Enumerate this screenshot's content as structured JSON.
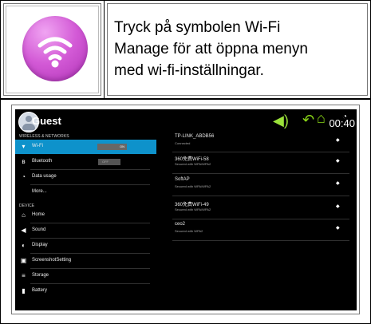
{
  "instruction": {
    "line1": "Tryck på symbolen Wi-Fi",
    "line2": "Manage för att öppna menyn",
    "line3": "med wi-fi-inställningar."
  },
  "status_bar": {
    "user": "Guest",
    "clock": "00:40",
    "icons": [
      "volume-icon",
      "back-icon",
      "home-icon",
      "wifi-signal-icon"
    ]
  },
  "settings": {
    "wireless_section": "WIRELESS & NETWORKS",
    "device_section": "DEVICE",
    "items": [
      {
        "label": "Wi-Fi",
        "icon": "wifi-icon",
        "toggle": "ON"
      },
      {
        "label": "Bluetooth",
        "icon": "bluetooth-icon",
        "toggle": "OFF"
      },
      {
        "label": "Data usage",
        "icon": "data-usage-icon"
      },
      {
        "label": "More..."
      },
      {
        "label": "Home",
        "icon": "home-icon"
      },
      {
        "label": "Sound",
        "icon": "speaker-icon"
      },
      {
        "label": "Display",
        "icon": "display-icon"
      },
      {
        "label": "ScreenshotSetting",
        "icon": "screenshot-icon"
      },
      {
        "label": "Storage",
        "icon": "storage-icon"
      },
      {
        "label": "Battery",
        "icon": "battery-icon"
      }
    ]
  },
  "networks": [
    {
      "name": "TP-LINK_ABDB56",
      "status": "Connected"
    },
    {
      "name": "360免费WiFi-58",
      "status": "Secured with WPA/WPA2"
    },
    {
      "name": "SoftAP",
      "status": "Secured with WPA/WPA2"
    },
    {
      "name": "360免费WiFi-49",
      "status": "Secured with WPA/WPA2"
    },
    {
      "name": "ceo2",
      "status": "Secured with WPA2"
    }
  ],
  "colors": {
    "accent": "#0e92cb",
    "screen_background": "#000000",
    "volume_icon": "#9be23a",
    "nav_icon": "#8bd817"
  }
}
